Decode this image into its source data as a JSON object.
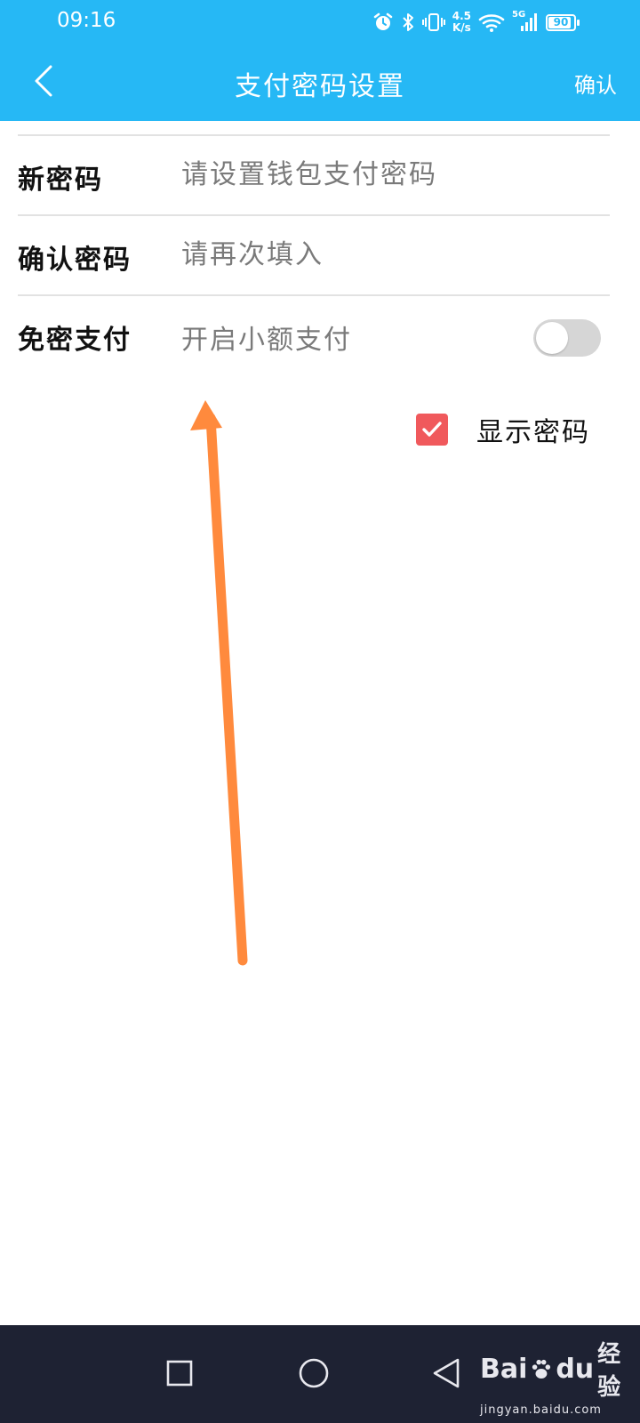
{
  "status_bar": {
    "time": "09:16",
    "speed_value": "4.5",
    "speed_unit": "K/s",
    "network": "5G",
    "battery": "90",
    "battery_level": 0.9
  },
  "header": {
    "title": "支付密码设置",
    "confirm_label": "确认",
    "background_color": "#26b8f5"
  },
  "form": {
    "new_password": {
      "label": "新密码",
      "placeholder": "请设置钱包支付密码",
      "value": ""
    },
    "confirm_password": {
      "label": "确认密码",
      "placeholder": "请再次填入",
      "value": ""
    },
    "password_free": {
      "label": "免密支付",
      "hint": "开启小额支付",
      "enabled": false
    }
  },
  "show_password": {
    "label": "显示密码",
    "checked": true,
    "color": "#f0595c"
  },
  "annotation": {
    "color": "#ff8a3d"
  },
  "watermark": {
    "logo_text": "Bai",
    "logo_text_2": "du",
    "service": "经验",
    "url": "jingyan.baidu.com"
  },
  "system_nav": {
    "icons": [
      "recent-apps-icon",
      "home-icon",
      "back-triangle-icon"
    ]
  }
}
